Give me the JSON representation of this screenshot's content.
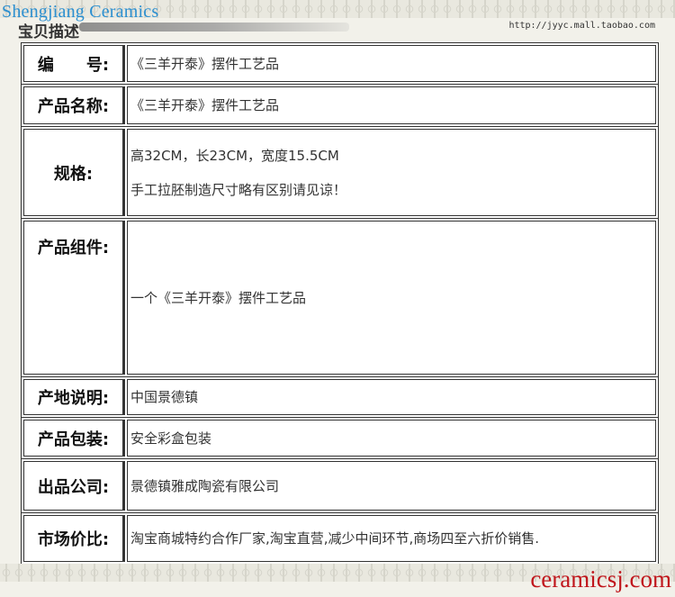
{
  "watermark_top": "Shengjiang Ceramics",
  "header": {
    "title": "宝贝描述",
    "url": "http://jyyc.mall.taobao.com"
  },
  "rows": [
    {
      "label": "编　　号:",
      "lines": [
        "《三羊开泰》摆件工艺品"
      ]
    },
    {
      "label": "产品名称:",
      "lines": [
        " 《三羊开泰》摆件工艺品"
      ]
    },
    {
      "label": "规格:",
      "lines": [
        "高32CM，长23CM，宽度15.5CM",
        "手工拉胚制造尺寸略有区别请见谅！"
      ]
    },
    {
      "label": "产品组件:",
      "lines": [
        "一个《三羊开泰》摆件工艺品"
      ]
    },
    {
      "label": "产地说明:",
      "lines": [
        "中国景德镇"
      ]
    },
    {
      "label": "产品包装:",
      "lines": [
        "安全彩盒包装"
      ]
    },
    {
      "label": "出品公司:",
      "lines": [
        "景德镇雅成陶瓷有限公司"
      ]
    },
    {
      "label": "市场价比:",
      "lines": [
        "淘宝商城特约合作厂家,淘宝直营,减少中间环节,商场四至六折价销售."
      ]
    }
  ],
  "watermark_bottom": "ceramicsj.com"
}
